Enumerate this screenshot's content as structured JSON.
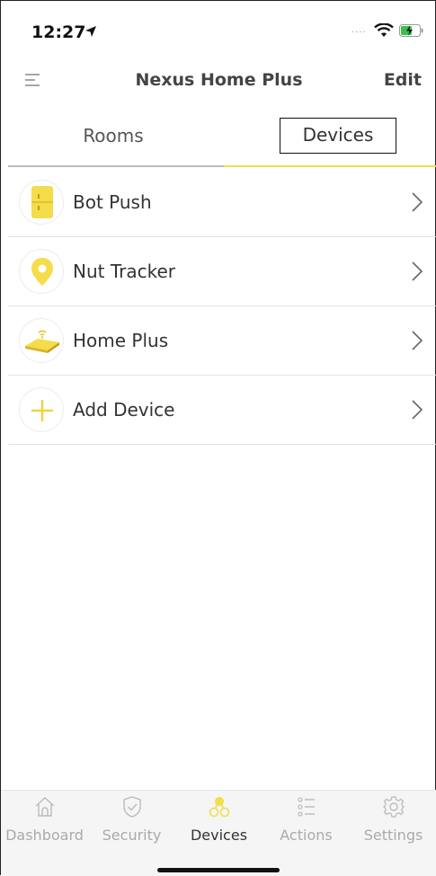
{
  "status": {
    "time": "12:27"
  },
  "header": {
    "title": "Nexus Home Plus",
    "edit_label": "Edit"
  },
  "tabs": {
    "rooms_label": "Rooms",
    "devices_label": "Devices",
    "active": "Devices"
  },
  "devices": [
    {
      "label": "Bot Push",
      "icon": "bot-push-icon"
    },
    {
      "label": "Nut Tracker",
      "icon": "location-pin-icon"
    },
    {
      "label": "Home Plus",
      "icon": "home-plus-hub-icon"
    },
    {
      "label": "Add Device",
      "icon": "plus-icon"
    }
  ],
  "bottom_nav": [
    {
      "label": "Dashboard",
      "icon": "home-icon"
    },
    {
      "label": "Security",
      "icon": "shield-icon"
    },
    {
      "label": "Devices",
      "icon": "devices-icon",
      "active": true
    },
    {
      "label": "Actions",
      "icon": "list-icon"
    },
    {
      "label": "Settings",
      "icon": "gear-icon"
    }
  ],
  "colors": {
    "accent": "#f4dc4b",
    "accent_dark": "#e8c52e",
    "text": "#333333",
    "inactive_tab": "#aaaaaa"
  }
}
